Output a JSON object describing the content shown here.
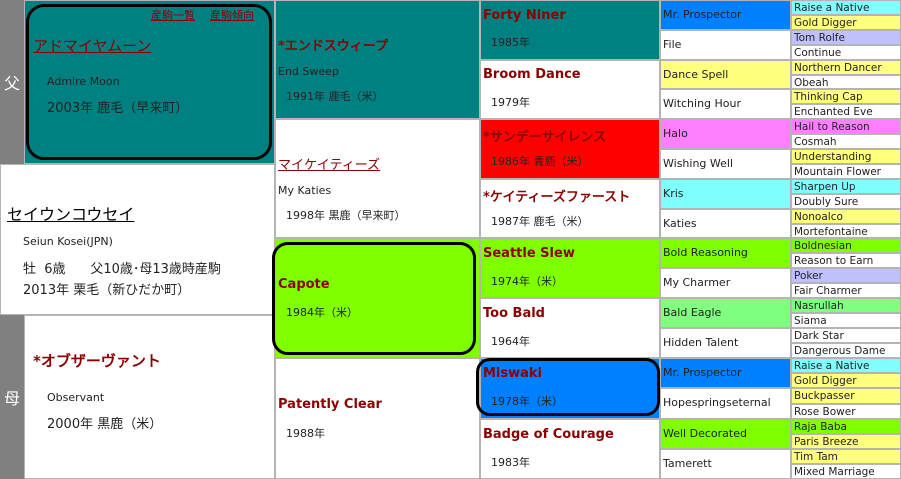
{
  "colors": {
    "teal": "#008080",
    "cyan": "#80ffff",
    "red": "#ff0000",
    "lime": "#80ff00",
    "blue": "#0080ff",
    "yellow": "#ffff80",
    "pink": "#ff80ff",
    "green": "#80ff80",
    "lavender": "#c0c0ff",
    "gray": "#808080"
  },
  "side_labels": {
    "sire": "父",
    "dam": "母"
  },
  "subject": {
    "name": "セイウンコウセイ",
    "name_en": "Seiun Kosei(JPN)",
    "line1": "牡  6歳      父10歳･母13歳時産駒",
    "line2": "2013年  栗毛（新ひだか町）"
  },
  "sire": {
    "links": [
      "産駒一覧",
      "産駒傾向"
    ],
    "name": "アドマイヤムーン",
    "name_en": "Admire Moon",
    "info": "2003年  鹿毛（早来町）"
  },
  "dam": {
    "name": "*オブザーヴァント",
    "name_en": "Observant",
    "info": "2000年  黒鹿（米）"
  },
  "gen2": [
    {
      "name": "*エンドスウィープ",
      "name_en": "End Sweep",
      "info": "1991年  鹿毛（米）"
    },
    {
      "name": "マイケイティーズ",
      "name_en": "My Katies",
      "info": "1998年  黒鹿（早来町）"
    },
    {
      "name": "Capote",
      "info": "1984年（米）"
    },
    {
      "name": "Patently Clear",
      "info": "1988年"
    }
  ],
  "gen3": [
    {
      "name": "Forty Niner",
      "info": "1985年"
    },
    {
      "name": "Broom Dance",
      "info": "1979年"
    },
    {
      "name": "*サンデーサイレンス",
      "info": "1986年  青鹿（米）"
    },
    {
      "name": "*ケイティーズファースト",
      "info": "1987年  鹿毛（米）"
    },
    {
      "name": "Seattle Slew",
      "info": "1974年（米）"
    },
    {
      "name": "Too Bald",
      "info": "1964年"
    },
    {
      "name": "Miswaki",
      "info": "1978年（米）"
    },
    {
      "name": "Badge of Courage",
      "info": "1983年"
    }
  ],
  "gen4": [
    "Mr. Prospector",
    "File",
    "Dance Spell",
    "Witching Hour",
    "Halo",
    "Wishing Well",
    "Kris",
    "Katies",
    "Bold Reasoning",
    "My Charmer",
    "Bald Eagle",
    "Hidden Talent",
    "Mr. Prospector",
    "Hopespringseternal",
    "Well Decorated",
    "Tamerett"
  ],
  "gen5": [
    "Raise a Native",
    "Gold Digger",
    "Tom Rolfe",
    "Continue",
    "Northern Dancer",
    "Obeah",
    "Thinking Cap",
    "Enchanted Eve",
    "Hail to Reason",
    "Cosmah",
    "Understanding",
    "Mountain Flower",
    "Sharpen Up",
    "Doubly Sure",
    "Nonoalco",
    "Mortefontaine",
    "Boldnesian",
    "Reason to Earn",
    "Poker",
    "Fair Charmer",
    "Nasrullah",
    "Siama",
    "Dark Star",
    "Dangerous Dame",
    "Raise a Native",
    "Gold Digger",
    "Buckpasser",
    "Rose Bower",
    "Raja Baba",
    "Paris Breeze",
    "Tim Tam",
    "Mixed Marriage"
  ]
}
